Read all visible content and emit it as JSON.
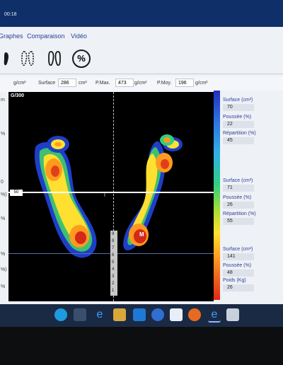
{
  "titlebar": {
    "time": "00:18"
  },
  "menu": {
    "items": [
      "Graphes",
      "Comparaison",
      "Vidéo"
    ]
  },
  "toolbar": {
    "icons": [
      "single-foot-icon",
      "feet-pattern-icon",
      "feet-pressure-icon",
      "percent-icon"
    ],
    "percent": "%"
  },
  "stats": {
    "unit1": "g/cm²",
    "surface_label": "Surface",
    "surface_value": "286",
    "surface_unit": "cm²",
    "pmax_label": "P.Max.",
    "pmax_value": "473",
    "pmax_unit": "g/cm²",
    "pmoy_label": "P.Moy.",
    "pmoy_value": "196",
    "pmoy_unit": "g/cm²"
  },
  "left_column": [
    "m",
    "%",
    "0",
    "%)",
    "%",
    "%",
    "%)",
    "%"
  ],
  "plot": {
    "label": "G/300",
    "marker": "50",
    "ruler_digits": [
      "9",
      "8",
      "7",
      "6",
      "5",
      "4",
      "3",
      "2",
      "1"
    ],
    "max_label": "M"
  },
  "right_panel": {
    "group1": {
      "surface_label": "Surface (cm²)",
      "surface_value": "70",
      "poussee_label": "Poussée (%)",
      "poussee_value": "22",
      "repartition_label": "Répartition (%)",
      "repartition_value": "45"
    },
    "group2": {
      "surface_label": "Surface (cm²)",
      "surface_value": "71",
      "poussee_label": "Poussée (%)",
      "poussee_value": "26",
      "repartition_label": "Répartition (%)",
      "repartition_value": "55"
    },
    "group3": {
      "surface_label": "Surface (cm²)",
      "surface_value": "141",
      "poussee_label": "Poussée (%)",
      "poussee_value": "48",
      "poids_label": "Poids (Kg)",
      "poids_value": "26"
    }
  },
  "taskbar": {
    "icons": [
      "skype-icon",
      "store-icon",
      "edge-icon",
      "explorer-icon",
      "dropbox-icon",
      "chrome-icon",
      "mail-icon",
      "firefox-icon",
      "edge-active-icon",
      "app-icon"
    ]
  },
  "colors": {
    "titlebar": "#0e2f68",
    "accent": "#2a3f9a",
    "plot_bg": "#000000"
  }
}
